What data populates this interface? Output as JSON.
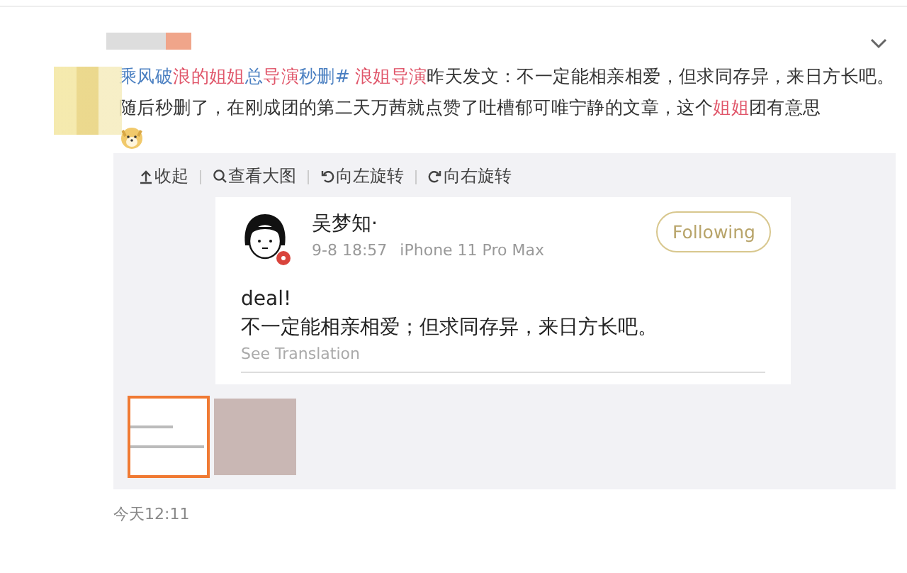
{
  "post": {
    "segments": [
      {
        "text": "乘风破",
        "kind": "link"
      },
      {
        "text": "浪的",
        "kind": "highlight"
      },
      {
        "text": "姐姐",
        "kind": "highlight"
      },
      {
        "text": "总",
        "kind": "link"
      },
      {
        "text": "导演",
        "kind": "highlight"
      },
      {
        "text": "秒删#",
        "kind": "link"
      },
      {
        "text": " 浪姐导演",
        "kind": "highlight"
      },
      {
        "text": "昨天发文：不一定能相亲相爱，但求同存异，来日方长吧。随后秒删了，在刚成团的第二天万茜就点赞了吐槽郁可唯宁静的文章，这个",
        "kind": "plain"
      },
      {
        "text": "姐姐",
        "kind": "highlight"
      },
      {
        "text": "团有意思",
        "kind": "plain"
      }
    ],
    "timestamp": "今天12:11"
  },
  "toolbar": [
    {
      "label": "收起",
      "kind": "collapse"
    },
    {
      "label": "查看大图",
      "kind": "zoom"
    },
    {
      "label": "向左旋转",
      "kind": "rotate-left"
    },
    {
      "label": "向右旋转",
      "kind": "rotate-right"
    }
  ],
  "embedded_post": {
    "name": "吴梦知·",
    "date": "9-8 18:57",
    "device": "iPhone 11 Pro Max",
    "follow_button": "Following",
    "lines": [
      "deal!",
      "不一定能相亲相爱；但求同存异，来日方长吧。"
    ],
    "translate_link": "See Translation"
  },
  "thumbnails": [
    {
      "kind": "screenshot",
      "selected": true
    },
    {
      "kind": "photo",
      "selected": false
    }
  ]
}
